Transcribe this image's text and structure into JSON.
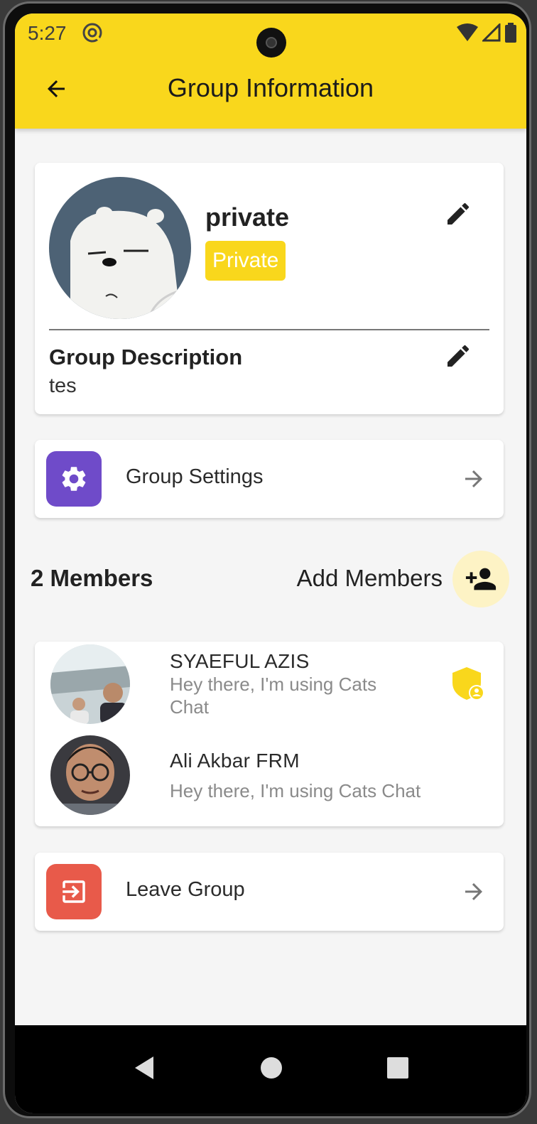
{
  "status_bar": {
    "time": "5:27"
  },
  "app_bar": {
    "title": "Group Information"
  },
  "group": {
    "name": "private",
    "privacy_badge": "Private",
    "description_label": "Group Description",
    "description": "tes"
  },
  "group_settings": {
    "label": "Group Settings"
  },
  "members_section": {
    "count_label": "2 Members",
    "add_label": "Add Members",
    "members": [
      {
        "name": "SYAEFUL AZIS",
        "status": "Hey there, I'm using Cats Chat",
        "is_admin": true
      },
      {
        "name": "Ali Akbar FRM",
        "status": "Hey there, I'm using Cats Chat",
        "is_admin": false
      }
    ]
  },
  "leave_group": {
    "label": "Leave Group"
  },
  "colors": {
    "primary": "#f9d71c",
    "settings_icon_bg": "#6f4bc9",
    "leave_icon_bg": "#e85a4a",
    "add_member_bg": "#fdf3c5"
  },
  "icons": [
    "arrow-back-icon",
    "edit-icon",
    "gear-icon",
    "arrow-forward-icon",
    "person-add-icon",
    "admin-shield-icon",
    "exit-icon",
    "nav-back-icon",
    "nav-home-icon",
    "nav-recents-icon"
  ]
}
